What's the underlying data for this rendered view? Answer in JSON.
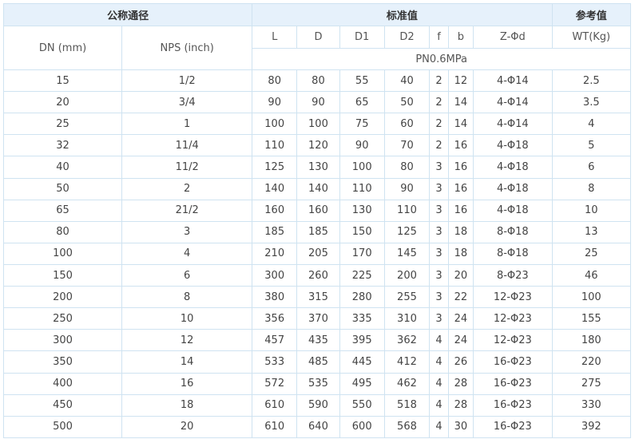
{
  "header": {
    "group_nominal": "公称通径",
    "group_standard": "标准值",
    "group_reference": "参考值",
    "dn": "DN (mm)",
    "nps": "NPS (inch)",
    "L": "L",
    "D": "D",
    "D1": "D1",
    "D2": "D2",
    "f": "f",
    "b": "b",
    "zd": "Z-Φd",
    "wt": "WT(Kg)",
    "pressure": "PN0.6MPa"
  },
  "rows": [
    {
      "dn": "15",
      "nps": "1/2",
      "L": "80",
      "D": "80",
      "D1": "55",
      "D2": "40",
      "f": "2",
      "b": "12",
      "zd": "4-Φ14",
      "wt": "2.5"
    },
    {
      "dn": "20",
      "nps": "3/4",
      "L": "90",
      "D": "90",
      "D1": "65",
      "D2": "50",
      "f": "2",
      "b": "14",
      "zd": "4-Φ14",
      "wt": "3.5"
    },
    {
      "dn": "25",
      "nps": "1",
      "L": "100",
      "D": "100",
      "D1": "75",
      "D2": "60",
      "f": "2",
      "b": "14",
      "zd": "4-Φ14",
      "wt": "4"
    },
    {
      "dn": "32",
      "nps": "11/4",
      "L": "110",
      "D": "120",
      "D1": "90",
      "D2": "70",
      "f": "2",
      "b": "16",
      "zd": "4-Φ18",
      "wt": "5"
    },
    {
      "dn": "40",
      "nps": "11/2",
      "L": "125",
      "D": "130",
      "D1": "100",
      "D2": "80",
      "f": "3",
      "b": "16",
      "zd": "4-Φ18",
      "wt": "6"
    },
    {
      "dn": "50",
      "nps": "2",
      "L": "140",
      "D": "140",
      "D1": "110",
      "D2": "90",
      "f": "3",
      "b": "16",
      "zd": "4-Φ18",
      "wt": "8"
    },
    {
      "dn": "65",
      "nps": "21/2",
      "L": "160",
      "D": "160",
      "D1": "130",
      "D2": "110",
      "f": "3",
      "b": "16",
      "zd": "4-Φ18",
      "wt": "10"
    },
    {
      "dn": "80",
      "nps": "3",
      "L": "185",
      "D": "185",
      "D1": "150",
      "D2": "125",
      "f": "3",
      "b": "18",
      "zd": "8-Φ18",
      "wt": "13"
    },
    {
      "dn": "100",
      "nps": "4",
      "L": "210",
      "D": "205",
      "D1": "170",
      "D2": "145",
      "f": "3",
      "b": "18",
      "zd": "8-Φ18",
      "wt": "25"
    },
    {
      "dn": "150",
      "nps": "6",
      "L": "300",
      "D": "260",
      "D1": "225",
      "D2": "200",
      "f": "3",
      "b": "20",
      "zd": "8-Φ23",
      "wt": "46"
    },
    {
      "dn": "200",
      "nps": "8",
      "L": "380",
      "D": "315",
      "D1": "280",
      "D2": "255",
      "f": "3",
      "b": "22",
      "zd": "12-Φ23",
      "wt": "100"
    },
    {
      "dn": "250",
      "nps": "10",
      "L": "356",
      "D": "370",
      "D1": "335",
      "D2": "310",
      "f": "3",
      "b": "24",
      "zd": "12-Φ23",
      "wt": "155"
    },
    {
      "dn": "300",
      "nps": "12",
      "L": "457",
      "D": "435",
      "D1": "395",
      "D2": "362",
      "f": "4",
      "b": "24",
      "zd": "12-Φ23",
      "wt": "180"
    },
    {
      "dn": "350",
      "nps": "14",
      "L": "533",
      "D": "485",
      "D1": "445",
      "D2": "412",
      "f": "4",
      "b": "26",
      "zd": "16-Φ23",
      "wt": "220"
    },
    {
      "dn": "400",
      "nps": "16",
      "L": "572",
      "D": "535",
      "D1": "495",
      "D2": "462",
      "f": "4",
      "b": "28",
      "zd": "16-Φ23",
      "wt": "275"
    },
    {
      "dn": "450",
      "nps": "18",
      "L": "610",
      "D": "590",
      "D1": "550",
      "D2": "518",
      "f": "4",
      "b": "28",
      "zd": "16-Φ23",
      "wt": "330"
    },
    {
      "dn": "500",
      "nps": "20",
      "L": "610",
      "D": "640",
      "D1": "600",
      "D2": "568",
      "f": "4",
      "b": "30",
      "zd": "16-Φ23",
      "wt": "392"
    }
  ]
}
